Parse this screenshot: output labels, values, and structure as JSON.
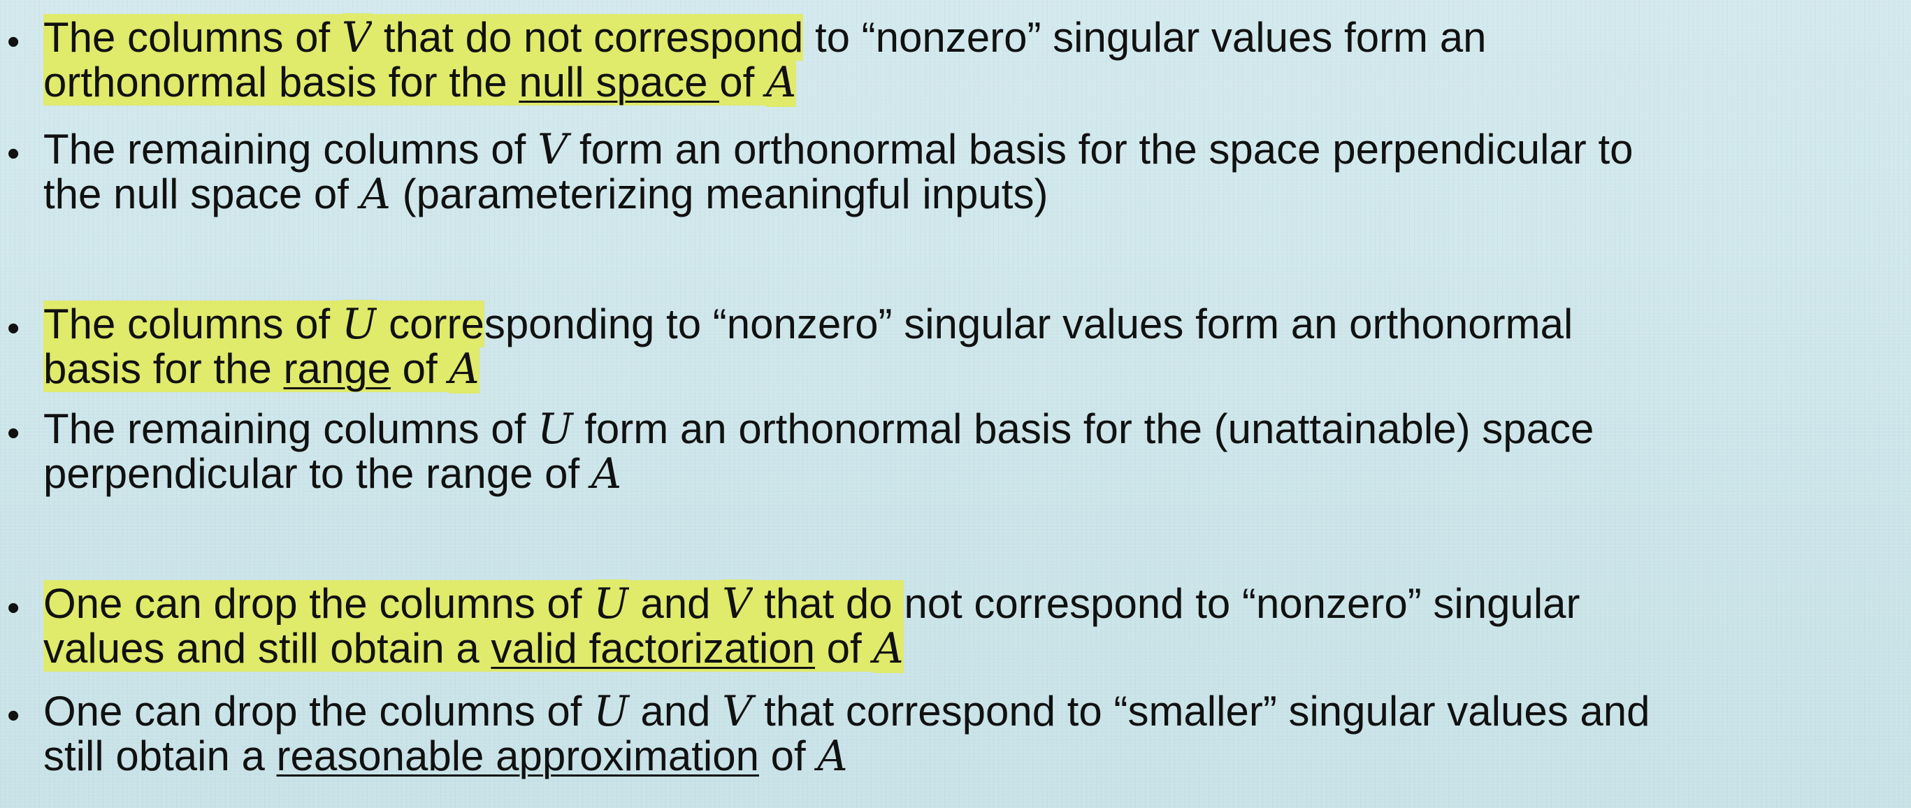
{
  "bullet_glyph": "•",
  "highlight_color": "#e0ea6b",
  "background_color": "#cfe6ea",
  "bullets": [
    {
      "line1": [
        {
          "hl": "The columns of "
        },
        {
          "hl_math": "V"
        },
        {
          "hl": " that do not correspond"
        },
        {
          "plain": " to “nonzero” singular values form an"
        }
      ],
      "line2": [
        {
          "hl": "orthonormal basis for the "
        },
        {
          "hl_u": "null space "
        },
        {
          "hl": "of "
        },
        {
          "hl_math": "A"
        }
      ]
    },
    {
      "line1": [
        {
          "plain": "The remaining columns of "
        },
        {
          "math": "V"
        },
        {
          "plain": " form an orthonormal basis for the space perpendicular to"
        }
      ],
      "line2": [
        {
          "plain": "the null space of "
        },
        {
          "math": "A"
        },
        {
          "plain": " (parameterizing meaningful inputs)"
        }
      ]
    },
    {
      "line1": [
        {
          "hl": "The columns of "
        },
        {
          "hl_math": "U"
        },
        {
          "hl": " corre"
        },
        {
          "plain": "sponding to “nonzero” singular values form an orthonormal"
        }
      ],
      "line2": [
        {
          "hl": "basis for the "
        },
        {
          "hl_u": "range"
        },
        {
          "hl": " of "
        },
        {
          "hl_math": "A"
        }
      ]
    },
    {
      "line1": [
        {
          "plain": "The remaining columns of "
        },
        {
          "math": "U"
        },
        {
          "plain": " form an orthonormal basis for the (unattainable) space"
        }
      ],
      "line2": [
        {
          "plain": "perpendicular to the range of "
        },
        {
          "math": "A"
        }
      ]
    },
    {
      "line1": [
        {
          "hl": "One can drop the columns of "
        },
        {
          "hl_math": "U"
        },
        {
          "hl": " and "
        },
        {
          "hl_math": "V"
        },
        {
          "hl": " that do "
        },
        {
          "plain": "not correspond to “nonzero” singular"
        }
      ],
      "line2": [
        {
          "hl": "values and still obtain a "
        },
        {
          "hl_u": "valid factorization"
        },
        {
          "hl": " of "
        },
        {
          "hl_math": "A"
        }
      ]
    },
    {
      "line1": [
        {
          "plain": "One can drop the columns of "
        },
        {
          "math": "U"
        },
        {
          "plain": " and "
        },
        {
          "math": "V"
        },
        {
          "plain": " that correspond to “smaller” singular values and"
        }
      ],
      "line2": [
        {
          "plain": "still obtain a "
        },
        {
          "u": "reasonable approximation"
        },
        {
          "plain": " of "
        },
        {
          "math": "A"
        }
      ]
    }
  ]
}
